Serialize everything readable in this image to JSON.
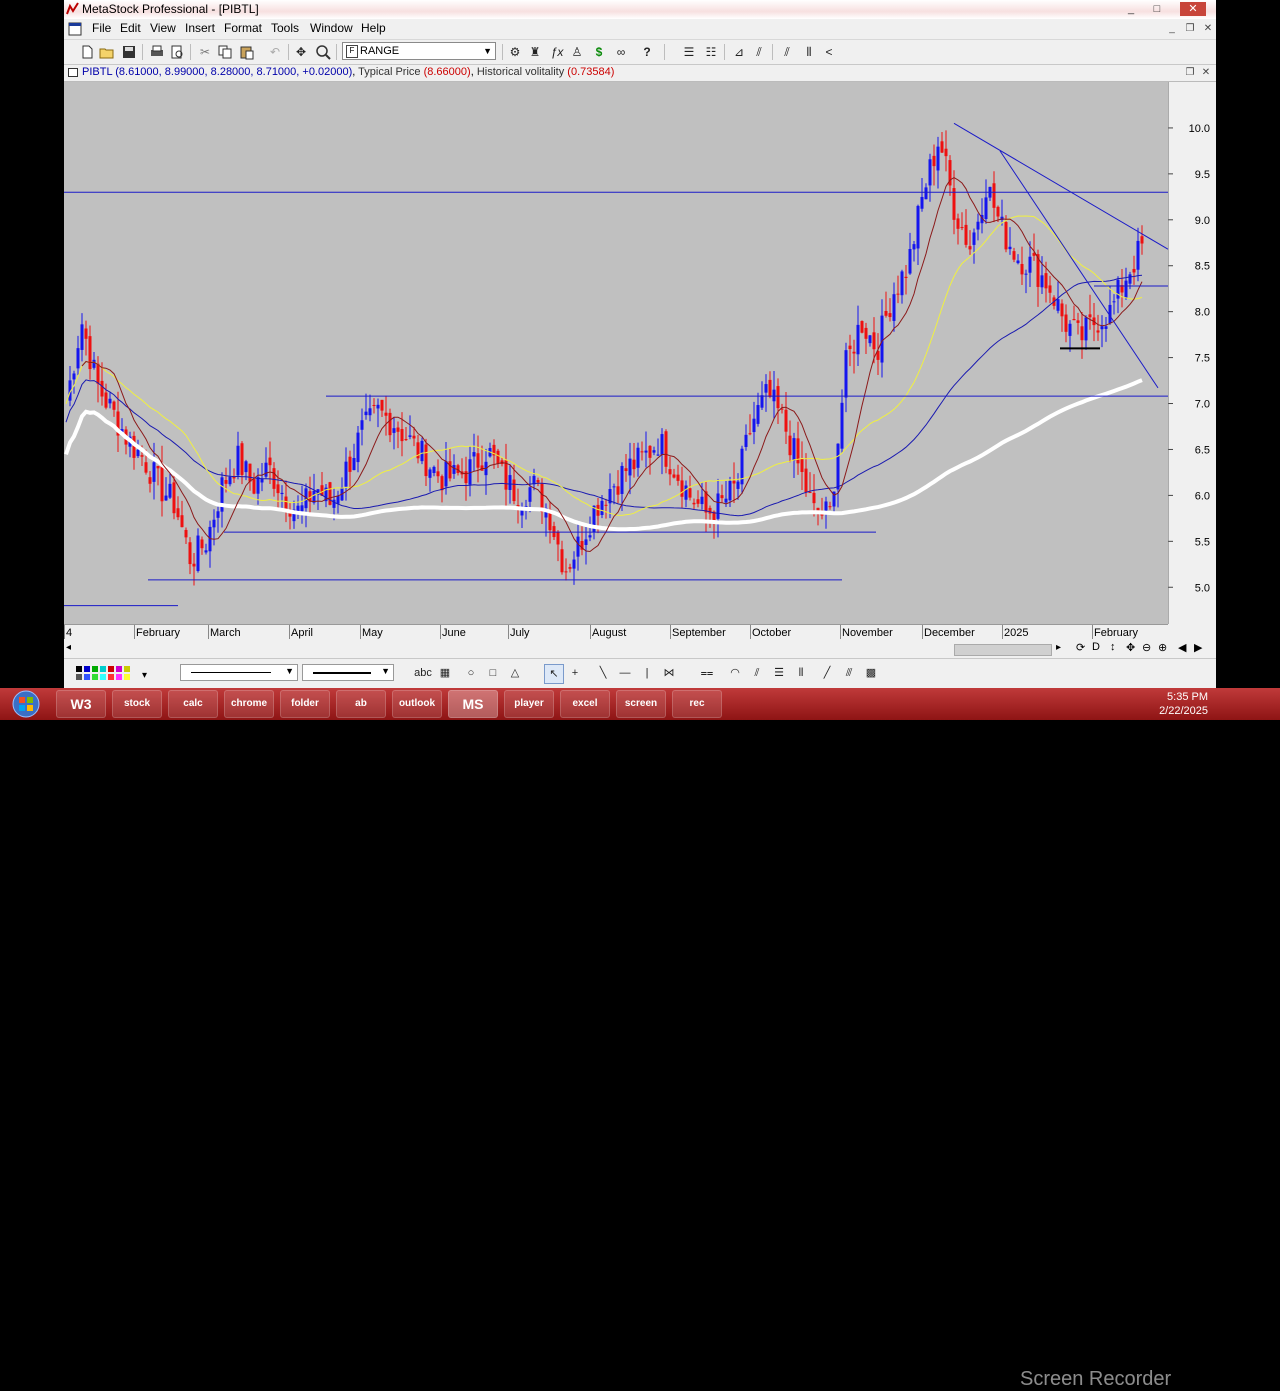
{
  "window": {
    "title": "MetaStock Professional - [PIBTL]",
    "minimize": "_",
    "maximize": "□",
    "close": "✕"
  },
  "menu": [
    "File",
    "Edit",
    "View",
    "Insert",
    "Format",
    "Tools",
    "Window",
    "Help"
  ],
  "toolbar": {
    "combo_value": "RANGE",
    "icons": [
      "new-icon",
      "open-icon",
      "save-icon",
      "print-icon",
      "print-preview-icon",
      "cut-icon",
      "copy-icon",
      "paste-icon",
      "undo-icon",
      "pan-icon",
      "zoom-icon",
      "explorer-icon",
      "expert-icon",
      "indicator-icon",
      "dollar-icon",
      "binoculars-icon",
      "help-icon",
      "format-icon",
      "properties-icon",
      "trendline-icon",
      "fan-icon",
      "channel-icon",
      "bars-icon",
      "arc-icon"
    ]
  },
  "info": {
    "security": "PIBTL",
    "ohlc": "(8.61000, 8.99000, 8.28000, 8.71000, +0.02000)",
    "ind1_name": "Typical Price",
    "ind1_value": "(8.66000)",
    "ind2_name": "Historical volitality",
    "ind2_value": "(0.73584)",
    "colors": {
      "security": "#0000aa",
      "ind1": "#cc0000",
      "ind2": "#cc0000"
    }
  },
  "chart_data": {
    "type": "candlestick",
    "title": "",
    "ylim": [
      4.6,
      10.5
    ],
    "yticks": [
      "10.0",
      "9.5",
      "9.0",
      "8.5",
      "8.0",
      "7.5",
      "7.0",
      "6.5",
      "6.0",
      "5.5",
      "5.0"
    ],
    "xlabels": [
      "4",
      "February",
      "March",
      "April",
      "May",
      "June",
      "July",
      "August",
      "September",
      "October",
      "November",
      "December",
      "2025",
      "February"
    ],
    "price_path": [
      7.0,
      7.9,
      7.2,
      6.9,
      6.6,
      6.4,
      6.1,
      5.9,
      5.3,
      5.5,
      6.1,
      6.4,
      6.1,
      6.3,
      6.0,
      5.8,
      6.1,
      5.9,
      6.3,
      6.7,
      6.9,
      6.8,
      6.6,
      6.4,
      6.2,
      6.2,
      6.3,
      6.5,
      6.2,
      6.0,
      6.1,
      5.8,
      5.2,
      5.5,
      5.9,
      6.1,
      6.3,
      6.4,
      6.6,
      6.3,
      6.0,
      5.8,
      5.9,
      6.1,
      6.8,
      7.1,
      6.8,
      6.3,
      5.8,
      5.8,
      7.4,
      7.9,
      7.6,
      8.2,
      8.5,
      9.3,
      9.9,
      9.1,
      8.7,
      9.4,
      8.9,
      8.6,
      8.5,
      8.3,
      7.9,
      7.7,
      7.9,
      8.0,
      8.4,
      8.7
    ],
    "colors": {
      "up": "#1515ee",
      "down": "#ee1010",
      "ma_short": "#8b1a1a",
      "ma_mid": "#f0f040",
      "ma_long": "#1a1ab0",
      "ma_200": "#ffffff",
      "trendline": "#1a1ac8",
      "background": "#c0c0c0"
    }
  },
  "bottombar": {
    "icons": [
      "palette-icon",
      "line-style-icon",
      "line-weight-icon",
      "text-tool-icon",
      "grid-icon",
      "ellipse-icon",
      "rectangle-icon",
      "triangle-icon",
      "pointer-icon",
      "crosshair-icon",
      "line-tool-icon",
      "horizontal-line-icon",
      "vertical-line-icon",
      "cycle-icon",
      "fibonacci-icon",
      "speedline-icon",
      "gann-icon",
      "regression-icon",
      "trendline-tool-icon",
      "pitchfork-icon",
      "grid-tool-icon"
    ],
    "text_tool": "abc"
  },
  "taskbar": {
    "time": "5:35 PM",
    "date": "2/22/2025",
    "apps": [
      "W3",
      "stock",
      "calc",
      "chrome",
      "folder",
      "ab",
      "outlook",
      "MS",
      "player",
      "excel",
      "screen",
      "rec"
    ],
    "watermark": "Screen Recorder"
  }
}
